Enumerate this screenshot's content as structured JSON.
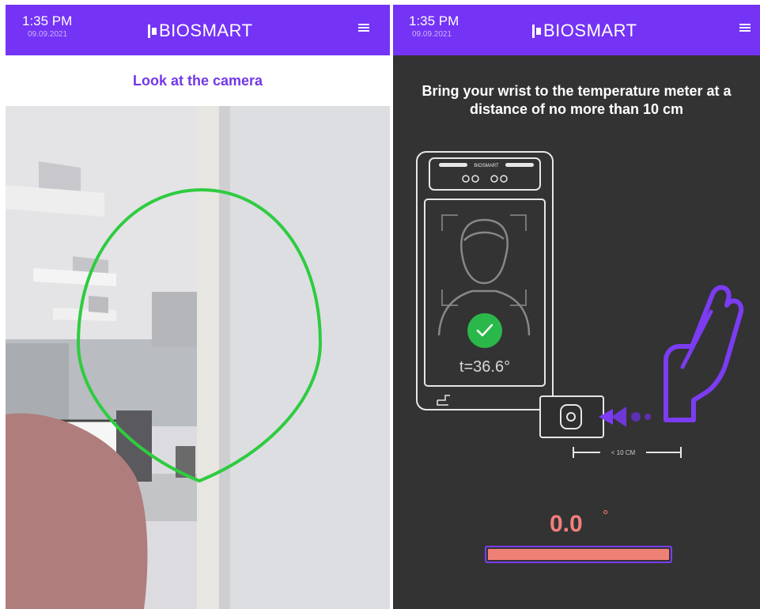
{
  "left_screen": {
    "status": {
      "time": "1:35 PM",
      "date": "09.09.2021"
    },
    "brand": "BIOSMART",
    "instruction": "Look at the camera"
  },
  "right_screen": {
    "status": {
      "time": "1:35 PM",
      "date": "09.09.2021"
    },
    "brand": "BIOSMART",
    "instruction": "Bring your wrist to the temperature meter at a distance of no more than 10 cm",
    "device_logo": "BIOSMART",
    "device_temperature": "t=36.6°",
    "distance_label": "< 10 CM",
    "temperature_value": "0.0",
    "temperature_unit": "°",
    "temperature_progress": 1.0
  },
  "colors": {
    "appbar": "#7433f5",
    "accent_purple": "#7238e8",
    "face_outline": "#2ecc40",
    "temperature": "#f27f7b",
    "dark_bg": "#333333"
  },
  "icons": [
    "menu-icon",
    "checkmark-icon",
    "hand-icon",
    "face-icon",
    "sensor-icon"
  ]
}
